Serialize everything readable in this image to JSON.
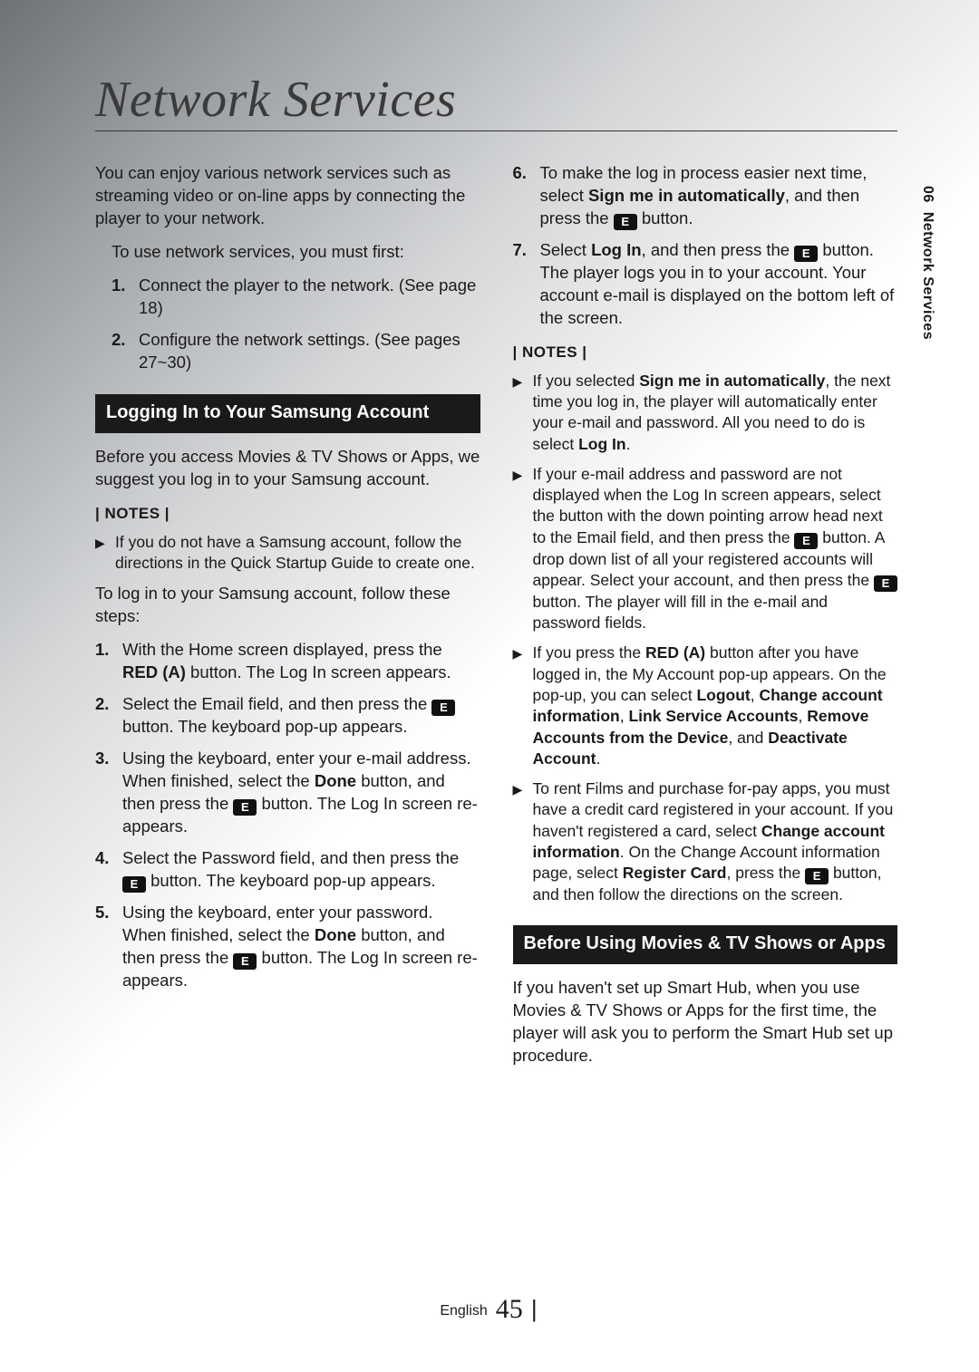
{
  "page": {
    "title": "Network Services",
    "sideTab": {
      "chapter": "06",
      "label": "Network Services"
    },
    "footer": {
      "lang": "English",
      "page": "45"
    }
  },
  "left": {
    "intro": "You can enjoy various network services such as streaming video or on-line apps by connecting the player to your network.",
    "prereqLead": "To use network services, you must first:",
    "prereq": [
      "Connect the player to the network. (See page 18)",
      "Configure the network settings. (See pages 27~30)"
    ],
    "sectionA": "Logging In to Your Samsung Account",
    "secApara": "Before you access Movies & TV Shows or Apps, we suggest you log in to your Samsung account.",
    "notesLabel": "| NOTES |",
    "noteA": "If you do not have a Samsung account, follow the directions in the Quick Startup Guide to create one.",
    "stepsLead": "To log in to your Samsung account, follow these steps:",
    "steps": {
      "s1a": "With the Home screen displayed, press the ",
      "s1b": "RED (A)",
      "s1c": " button. The Log In screen appears.",
      "s2a": "Select the Email field, and then press the ",
      "s2b": " button. The keyboard pop-up appears.",
      "s3a": "Using the keyboard, enter your e-mail address. When finished, select the ",
      "s3b": "Done",
      "s3c": " button, and then press the ",
      "s3d": " button. The Log In screen re-appears.",
      "s4a": "Select the Password field, and then press the ",
      "s4b": " button. The keyboard pop-up appears.",
      "s5a": "Using the keyboard, enter your password. When finished, select the ",
      "s5b": "Done",
      "s5c": " button, and then press the ",
      "s5d": " button. The Log In screen re-appears."
    }
  },
  "right": {
    "steps": {
      "s6a": "To make the log in process easier next time, select ",
      "s6b": "Sign me in automatically",
      "s6c": ", and then press the ",
      "s6d": " button.",
      "s7a": "Select ",
      "s7b": "Log In",
      "s7c": ", and then press the ",
      "s7d": " button. The player logs you in to your account. Your account e-mail is displayed on the bottom left of the screen."
    },
    "notesLabel": "| NOTES |",
    "notes": {
      "n1a": "If you selected ",
      "n1b": "Sign me in automatically",
      "n1c": ", the next time you log in, the player will automatically enter your e-mail and password. All you need to do is select ",
      "n1d": "Log In",
      "n1e": ".",
      "n2a": "If your e-mail address and password are not displayed when the Log In screen appears, select the button with the down pointing arrow head next to the Email field, and then press the ",
      "n2b": " button. A drop down list of all your registered accounts will appear. Select your account, and then press the ",
      "n2c": " button. The player will fill in the e-mail and password fields.",
      "n3a": "If you press the ",
      "n3b": "RED (A)",
      "n3c": " button after you have logged in, the My Account pop-up appears. On the pop-up, you can select ",
      "n3d": "Logout",
      "n3e": ", ",
      "n3f": "Change account information",
      "n3g": ", ",
      "n3h": "Link Service Accounts",
      "n3i": ", ",
      "n3j": "Remove Accounts from the Device",
      "n3k": ", and ",
      "n3l": "Deactivate Account",
      "n3m": ".",
      "n4a": "To rent Films and purchase for-pay apps, you must have a credit card registered in your account. If you haven't registered a card, select ",
      "n4b": "Change account information",
      "n4c": ". On the Change Account information page, select ",
      "n4d": "Register Card",
      "n4e": ", press the ",
      "n4f": " button, and then follow the directions on the screen."
    },
    "sectionB": "Before Using Movies & TV Shows or Apps",
    "secBpara": "If you haven't set up Smart Hub, when you use Movies & TV Shows or Apps for the first time, the player will ask you to perform the Smart Hub set up procedure."
  },
  "labels": {
    "n1": "1.",
    "n2": "2.",
    "n3": "3.",
    "n4": "4.",
    "n5": "5.",
    "n6": "6.",
    "n7": "7.",
    "enter": "E",
    "tri": "▶"
  }
}
